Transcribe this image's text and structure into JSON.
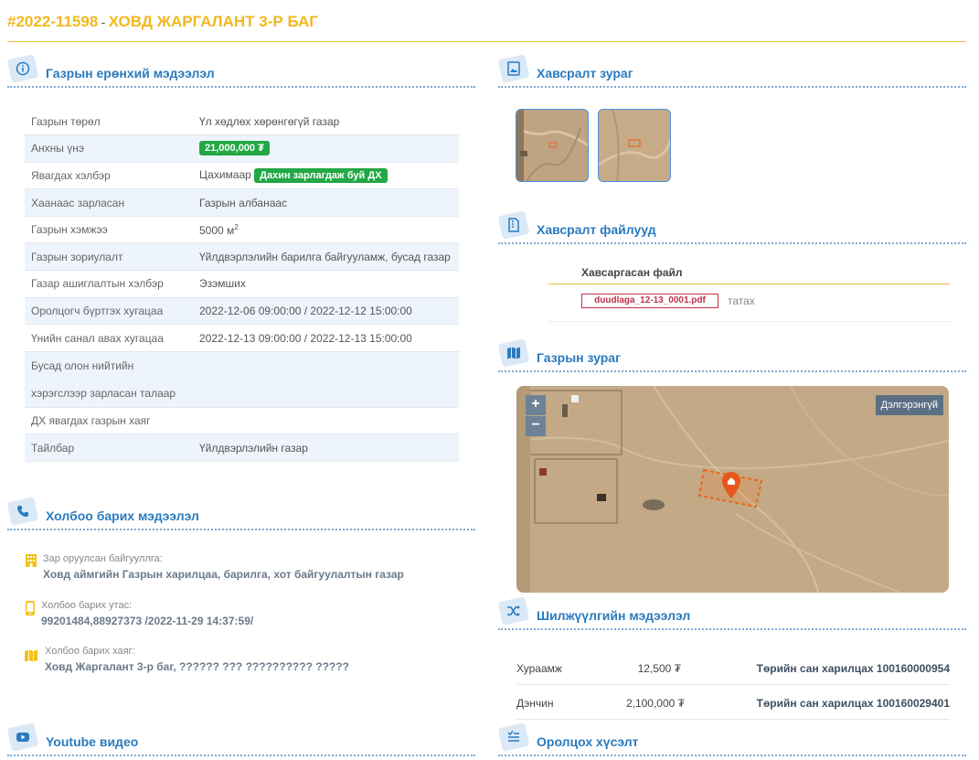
{
  "header": {
    "code": "#2022-11598",
    "separator": "-",
    "title": "ХОВД ЖАРГАЛАНТ 3-Р БАГ"
  },
  "sections": {
    "general": "Газрын ерөнхий мэдээлэл",
    "attachments_images": "Хавсралт зураг",
    "attachments_files": "Хавсралт файлууд",
    "map": "Газрын зураг",
    "contact": "Холбоо барих мэдээлэл",
    "transfer": "Шилжүүлгийн мэдээлэл",
    "youtube": "Youtube видео",
    "participants": "Оролцох хүсэлт"
  },
  "general_info": [
    {
      "key": "Газрын төрөл",
      "value": "Үл хөдлөх хөрөнгөгүй газар"
    },
    {
      "key": "Анхны үнэ",
      "value": "21,000,000 ₮",
      "pill": true
    },
    {
      "key": "Явагдах хэлбэр",
      "value": "Цахимаар",
      "extra_pill": "Дахин зарлагдаж буй ДХ"
    },
    {
      "key": "Хаанаас зарласан",
      "value": "Газрын албанаас"
    },
    {
      "key": "Газрын хэмжээ",
      "value": "5000 м",
      "sup": "2"
    },
    {
      "key": "Газрын зориулалт",
      "value": "Үйлдвэрлэлийн барилга байгууламж, бусад газар"
    },
    {
      "key": "Газар ашиглалтын хэлбэр",
      "value": "Эзэмших"
    },
    {
      "key": "Оролцогч бүртгэх хугацаа",
      "value": "2022-12-06 09:00:00 / 2022-12-12 15:00:00"
    },
    {
      "key": "Үнийн санал авах хугацаа",
      "value": "2022-12-13 09:00:00 / 2022-12-13 15:00:00"
    },
    {
      "key": "Бусад олон нийтийн хэрэгслээр зарласан талаар",
      "value": ""
    },
    {
      "key": "ДХ явагдах газрын хаяг",
      "value": ""
    },
    {
      "key": "Тайлбар",
      "value": "Үйлдвэрлэлийн газар"
    }
  ],
  "contact": {
    "org_label": "Зар оруулсан байгууллга:",
    "org_value": "Ховд аймгийн Газрын харилцаа, барилга, хот байгуулалтын газар",
    "phone_label": "Холбоо барих утас:",
    "phone_value": "99201484,88927373 /2022-11-29 14:37:59/",
    "address_label": "Холбоо барих хаяг:",
    "address_value": "Ховд Жаргалант 3-р баг, ?????? ??? ?????????? ?????"
  },
  "files": {
    "column_header": "Хавсаргасан файл",
    "items": [
      {
        "name": "duudlaga_12-13_0001.pdf",
        "action": "татах"
      }
    ]
  },
  "map": {
    "zoom_in": "+",
    "zoom_out": "−",
    "more_button": "Дэлгэрэнгүй"
  },
  "transfers": [
    {
      "type": "Хураамж",
      "amount": "12,500 ₮",
      "account": "Төрийн сан харилцах 100160000954"
    },
    {
      "type": "Дэнчин",
      "amount": "2,100,000 ₮",
      "account": "Төрийн сан харилцах 100160029401"
    }
  ],
  "colors": {
    "accent": "#2a7bbf",
    "title": "#f2b81c",
    "pill": "#22a845",
    "file": "#c0304a"
  }
}
